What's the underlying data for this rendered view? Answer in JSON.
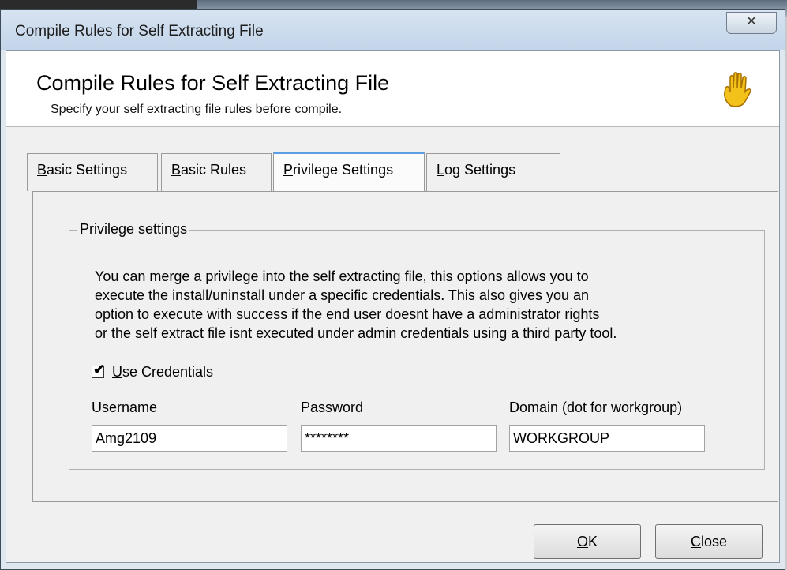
{
  "window": {
    "title": "Compile Rules for Self Extracting File",
    "close_glyph": "✕"
  },
  "header": {
    "title": "Compile Rules for Self Extracting File",
    "subtitle": "Specify your self extracting file rules before compile.",
    "icon": "hand-icon"
  },
  "tabs": [
    {
      "label": "Basic Settings",
      "first_letter": "B",
      "rest": "asic Settings",
      "active": false
    },
    {
      "label": "Basic Rules",
      "first_letter": "B",
      "rest": "asic Rules",
      "active": false
    },
    {
      "label": "Privilege Settings",
      "first_letter": "P",
      "rest": "rivilege Settings",
      "active": true
    },
    {
      "label": "Log Settings",
      "first_letter": "L",
      "rest": "og Settings",
      "active": false
    }
  ],
  "privilege": {
    "group_label": "Privilege settings",
    "description_lines": [
      "You can merge a privilege into the self extracting file, this options allows you to",
      "execute the install/uninstall under a specific credentials. This also gives you an",
      "option to execute with success if the end user doesnt have a administrator rights",
      "or the self extract file isnt executed under admin credentials using a third party tool."
    ],
    "use_credentials": {
      "first_letter": "U",
      "rest": "se Credentials",
      "checked": true,
      "check_glyph": "✔"
    },
    "username": {
      "label": "Username",
      "value": "Amg2109"
    },
    "password": {
      "label": "Password",
      "value": "********"
    },
    "domain": {
      "label": "Domain (dot for workgroup)",
      "value": "WORKGROUP"
    }
  },
  "buttons": {
    "ok": {
      "first_letter": "O",
      "rest": "K"
    },
    "close": {
      "first_letter": "C",
      "rest": "lose"
    }
  },
  "colors": {
    "active_tab_accent": "#5a9ee6",
    "hand_icon": "#f2c21b"
  }
}
